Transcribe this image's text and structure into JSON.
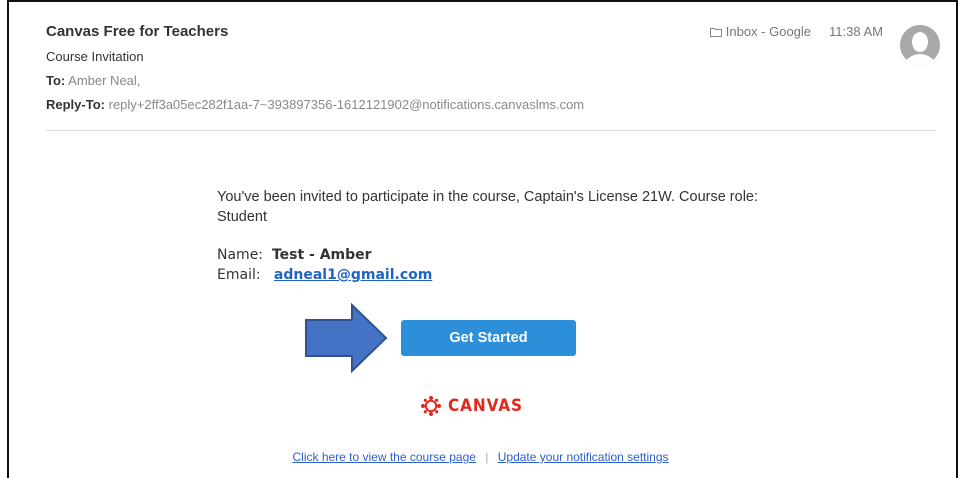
{
  "header": {
    "sender": "Canvas Free for Teachers",
    "subject": "Course Invitation",
    "to_label": "To:",
    "to_value": "Amber Neal,",
    "reply_to_label": "Reply-To:",
    "reply_to_value": "reply+2ff3a05ec282f1aa-7~393897356-1612121902@notifications.canvaslms.com",
    "folder": "Inbox - Google",
    "time": "11:38 AM"
  },
  "message": {
    "invitation_text": "You've been invited to participate in the course, Captain's License 21W. Course role: Student",
    "name_label": "Name:",
    "name_value": "Test - Amber",
    "email_label": "Email:",
    "email_value": "adneal1@gmail.com",
    "cta_button": "Get Started",
    "logo_text": "CANVAS"
  },
  "footer": {
    "course_link": "Click here to view the course page",
    "separator": "|",
    "notification_link": "Update your notification settings"
  },
  "colors": {
    "button": "#2d8fd9",
    "arrow": "#4472c4",
    "logo": "#e4271b",
    "link": "#2b5fcf"
  },
  "icons": [
    "folder-icon",
    "avatar-icon",
    "arrow-pointer",
    "canvas-logo-icon"
  ]
}
